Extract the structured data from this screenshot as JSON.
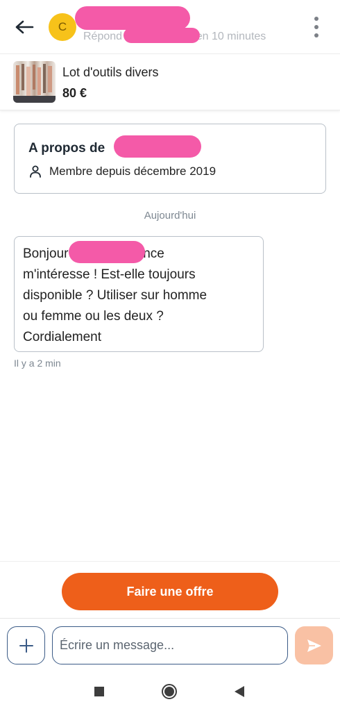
{
  "header": {
    "avatar_letter": "C",
    "subtitle": "Répond généralement en 10 minutes",
    "back_icon": "arrow-left-icon",
    "menu_icon": "more-vertical-icon"
  },
  "listing": {
    "title": "Lot d'outils divers",
    "price": "80 €"
  },
  "about": {
    "title_prefix": "A propos de",
    "member_since": "Membre depuis décembre 2019",
    "member_icon": "person-icon"
  },
  "conversation": {
    "day_label": "Aujourd'hui",
    "messages": [
      {
        "text": "Bonjour ! Votre annonce\nm'intéresse ! Est-elle toujours\ndisponible ? Utiliser sur homme\nou femme ou les deux ?\nCordialement",
        "time": "Il y a 2 min"
      }
    ]
  },
  "actions": {
    "offer_label": "Faire une offre"
  },
  "composer": {
    "placeholder": "Écrire un message...",
    "value": ""
  },
  "colors": {
    "accent": "#ee5f1a",
    "send_disabled": "#f9c1a4",
    "border": "#3a5a86",
    "avatar": "#f7c21a"
  }
}
